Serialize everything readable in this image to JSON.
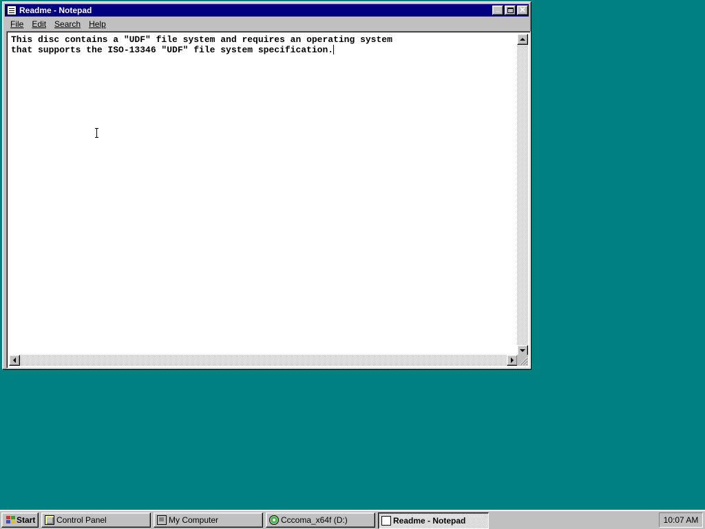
{
  "window": {
    "title": "Readme - Notepad",
    "buttons": {
      "minimize": "_",
      "maximize": "□",
      "close": "✕"
    }
  },
  "menu": [
    {
      "label": "File"
    },
    {
      "label": "Edit"
    },
    {
      "label": "Search"
    },
    {
      "label": "Help"
    }
  ],
  "document": {
    "line1": "This disc contains a \"UDF\" file system and requires an operating system",
    "line2": "that supports the ISO-13346 \"UDF\" file system specification."
  },
  "taskbar": {
    "start_label": "Start",
    "tasks": [
      {
        "label": "Control Panel",
        "icon": "control-panel-icon"
      },
      {
        "label": "My Computer",
        "icon": "my-computer-icon"
      },
      {
        "label": "Cccoma_x64f (D:)",
        "icon": "cd-drive-icon"
      },
      {
        "label": "Readme - Notepad",
        "icon": "notepad-icon",
        "active": true
      }
    ],
    "clock": "10:07 AM"
  },
  "colors": {
    "desktop": "#008080",
    "titlebar": "#000080",
    "face": "#c0c0c0"
  }
}
